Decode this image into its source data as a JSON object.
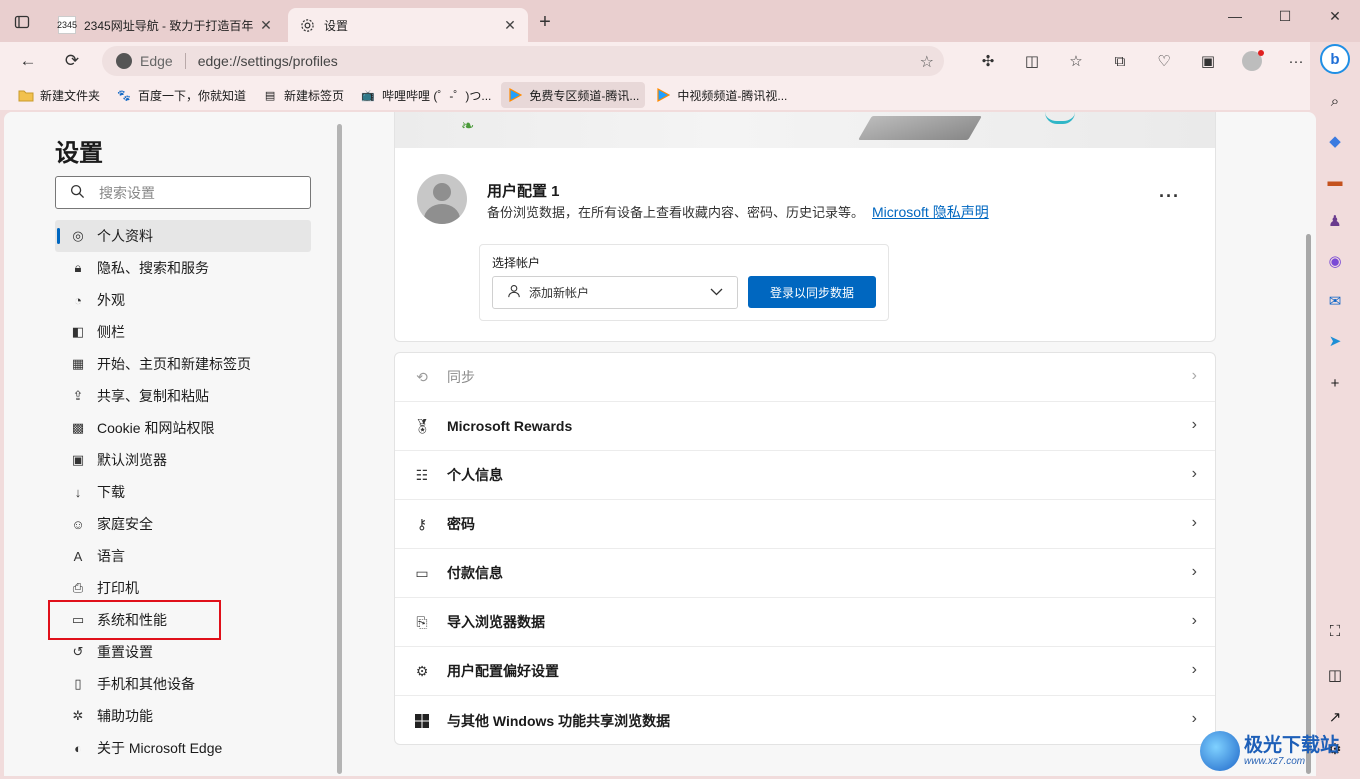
{
  "tabs": [
    {
      "title": "2345网址导航 - 致力于打造百年",
      "favicon": "2345",
      "close": "✕"
    },
    {
      "title": "设置",
      "close": "✕"
    }
  ],
  "window": {
    "minimize": "—",
    "maximize": "☐",
    "close": "✕"
  },
  "address_bar": {
    "chip_label": "Edge",
    "url": "edge://settings/profiles"
  },
  "bookmarks": [
    {
      "label": "新建文件夹",
      "icon": "folder-icon"
    },
    {
      "label": "百度一下，你就知道",
      "icon": "baidu-icon"
    },
    {
      "label": "新建标签页",
      "icon": "newtab-icon"
    },
    {
      "label": "哔哩哔哩 (゜-゜)つ...",
      "icon": "bilibili-icon"
    },
    {
      "label": "免费专区频道-腾讯...",
      "icon": "tencent-video-icon"
    },
    {
      "label": "中视频频道-腾讯视...",
      "icon": "tencent-video-icon"
    }
  ],
  "settings": {
    "title": "设置",
    "search_placeholder": "搜索设置",
    "nav": [
      {
        "label": "个人资料",
        "icon": "profile-icon",
        "active": true
      },
      {
        "label": "隐私、搜索和服务",
        "icon": "lock-icon"
      },
      {
        "label": "外观",
        "icon": "palette-icon"
      },
      {
        "label": "侧栏",
        "icon": "sidebar-icon"
      },
      {
        "label": "开始、主页和新建标签页",
        "icon": "home-icon"
      },
      {
        "label": "共享、复制和粘贴",
        "icon": "share-icon"
      },
      {
        "label": "Cookie 和网站权限",
        "icon": "cookie-icon"
      },
      {
        "label": "默认浏览器",
        "icon": "browser-icon"
      },
      {
        "label": "下载",
        "icon": "download-icon"
      },
      {
        "label": "家庭安全",
        "icon": "family-icon"
      },
      {
        "label": "语言",
        "icon": "language-icon"
      },
      {
        "label": "打印机",
        "icon": "printer-icon"
      },
      {
        "label": "系统和性能",
        "icon": "laptop-icon"
      },
      {
        "label": "重置设置",
        "icon": "reset-icon"
      },
      {
        "label": "手机和其他设备",
        "icon": "phone-icon"
      },
      {
        "label": "辅助功能",
        "icon": "accessibility-icon"
      },
      {
        "label": "关于 Microsoft Edge",
        "icon": "edge-icon"
      }
    ]
  },
  "profile": {
    "name": "用户配置 1",
    "description": "备份浏览数据，在所有设备上查看收藏内容、密码、历史记录等。",
    "privacy_link": "Microsoft 隐私声明",
    "more": "···",
    "account_label": "选择帐户",
    "account_select_value": "添加新帐户",
    "signin_button": "登录以同步数据"
  },
  "profile_rows": [
    {
      "label": "同步",
      "icon": "sync-icon",
      "disabled": true
    },
    {
      "label": "Microsoft Rewards",
      "icon": "rewards-icon"
    },
    {
      "label": "个人信息",
      "icon": "person-info-icon"
    },
    {
      "label": "密码",
      "icon": "key-icon"
    },
    {
      "label": "付款信息",
      "icon": "card-icon"
    },
    {
      "label": "导入浏览器数据",
      "icon": "import-icon"
    },
    {
      "label": "用户配置偏好设置",
      "icon": "profile-prefs-icon"
    },
    {
      "label": "与其他 Windows 功能共享浏览数据",
      "icon": "windows-icon"
    }
  ],
  "watermark": {
    "text": "极光下载站",
    "url": "www.xz7.com"
  },
  "colors": {
    "accent": "#0067c0",
    "highlight_box": "#e0101a",
    "frame": "#f1dcdc"
  }
}
